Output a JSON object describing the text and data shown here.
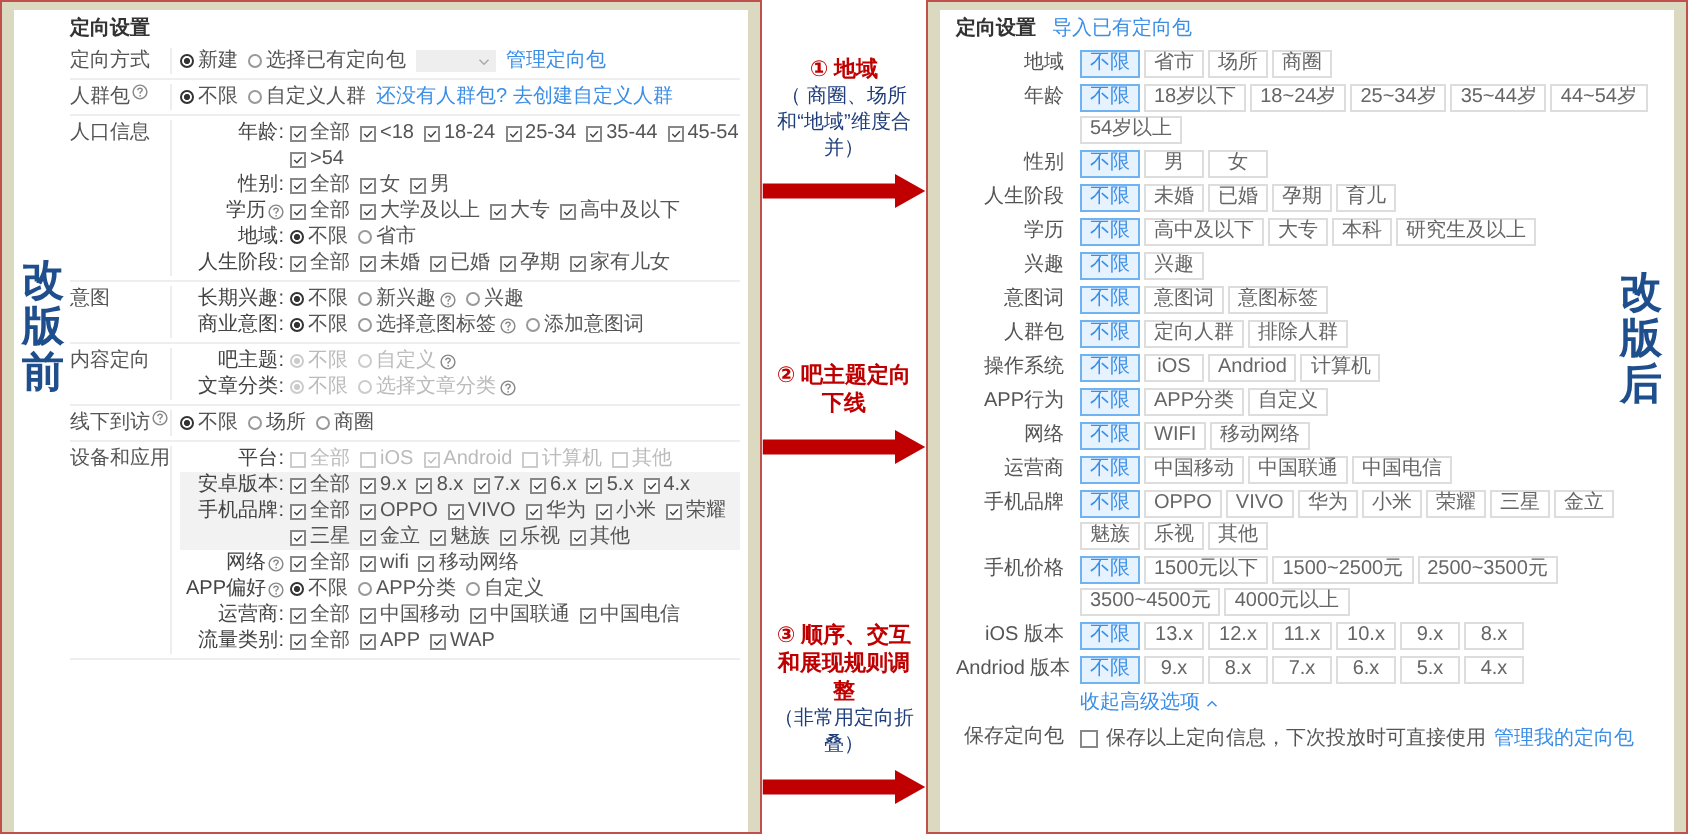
{
  "before": {
    "side_label": "改版前",
    "title": "定向设置",
    "sections": [
      {
        "label": "定向方式",
        "help": false,
        "rows": [
          {
            "kind": "radio",
            "disabled": false,
            "dropdown": true,
            "link": "管理定向包",
            "options": [
              {
                "text": "新建",
                "checked": true
              },
              {
                "text": "选择已有定向包",
                "checked": false
              }
            ]
          }
        ]
      },
      {
        "label": "人群包",
        "help": true,
        "rows": [
          {
            "kind": "radio",
            "disabled": false,
            "link": "还没有人群包? 去创建自定义人群",
            "options": [
              {
                "text": "不限",
                "checked": true
              },
              {
                "text": "自定义人群",
                "checked": false
              }
            ]
          }
        ]
      },
      {
        "label": "人口信息",
        "help": false,
        "rows": [
          {
            "label": "年龄:",
            "kind": "check",
            "disabled": false,
            "options": [
              {
                "text": "全部",
                "checked": true
              },
              {
                "text": "<18",
                "checked": true
              },
              {
                "text": "18-24",
                "checked": true
              },
              {
                "text": "25-34",
                "checked": true
              },
              {
                "text": "35-44",
                "checked": true
              },
              {
                "text": "45-54",
                "checked": true
              },
              {
                "text": ">54",
                "checked": true
              }
            ]
          },
          {
            "label": "性别:",
            "kind": "check",
            "disabled": false,
            "options": [
              {
                "text": "全部",
                "checked": true
              },
              {
                "text": "女",
                "checked": true
              },
              {
                "text": "男",
                "checked": true
              }
            ]
          },
          {
            "label": "学历",
            "help": true,
            "kind": "check",
            "disabled": false,
            "options": [
              {
                "text": "全部",
                "checked": true
              },
              {
                "text": "大学及以上",
                "checked": true
              },
              {
                "text": "大专",
                "checked": true
              },
              {
                "text": "高中及以下",
                "checked": true
              }
            ]
          },
          {
            "label": "地域:",
            "kind": "radio",
            "disabled": false,
            "options": [
              {
                "text": "不限",
                "checked": true
              },
              {
                "text": "省市",
                "checked": false
              }
            ]
          },
          {
            "label": "人生阶段:",
            "kind": "check",
            "disabled": false,
            "options": [
              {
                "text": "全部",
                "checked": true
              },
              {
                "text": "未婚",
                "checked": true
              },
              {
                "text": "已婚",
                "checked": true
              },
              {
                "text": "孕期",
                "checked": true
              },
              {
                "text": "家有儿女",
                "checked": true
              }
            ]
          }
        ]
      },
      {
        "label": "意图",
        "help": false,
        "rows": [
          {
            "label": "长期兴趣:",
            "kind": "radio",
            "disabled": false,
            "options": [
              {
                "text": "不限",
                "checked": true
              },
              {
                "text": "新兴趣",
                "checked": false,
                "help": true
              },
              {
                "text": "兴趣",
                "checked": false
              }
            ]
          },
          {
            "label": "商业意图:",
            "kind": "radio",
            "disabled": false,
            "options": [
              {
                "text": "不限",
                "checked": true
              },
              {
                "text": "选择意图标签",
                "checked": false,
                "help": true
              },
              {
                "text": "添加意图词",
                "checked": false
              }
            ]
          }
        ]
      },
      {
        "label": "内容定向",
        "help": false,
        "rows": [
          {
            "label": "吧主题:",
            "kind": "radio",
            "disabled": true,
            "options": [
              {
                "text": "不限",
                "checked": true
              },
              {
                "text": "自定义",
                "checked": false,
                "help": true
              }
            ]
          },
          {
            "label": "文章分类:",
            "kind": "radio",
            "disabled": true,
            "options": [
              {
                "text": "不限",
                "checked": true
              },
              {
                "text": "选择文章分类",
                "checked": false,
                "help": true
              }
            ]
          }
        ]
      },
      {
        "label": "线下到访",
        "help": true,
        "rows": [
          {
            "kind": "radio",
            "disabled": false,
            "options": [
              {
                "text": "不限",
                "checked": true
              },
              {
                "text": "场所",
                "checked": false
              },
              {
                "text": "商圈",
                "checked": false
              }
            ]
          }
        ]
      },
      {
        "label": "设备和应用",
        "help": false,
        "rows": [
          {
            "label": "平台:",
            "kind": "check",
            "disabled": true,
            "options": [
              {
                "text": "全部",
                "checked": false
              },
              {
                "text": "iOS",
                "checked": false
              },
              {
                "text": "Android",
                "checked": true
              },
              {
                "text": "计算机",
                "checked": false
              },
              {
                "text": "其他",
                "checked": false
              }
            ]
          },
          {
            "label": "安卓版本:",
            "kind": "check",
            "disabled": false,
            "boxed": true,
            "options": [
              {
                "text": "全部",
                "checked": true
              },
              {
                "text": "9.x",
                "checked": true
              },
              {
                "text": "8.x",
                "checked": true
              },
              {
                "text": "7.x",
                "checked": true
              },
              {
                "text": "6.x",
                "checked": true
              },
              {
                "text": "5.x",
                "checked": true
              },
              {
                "text": "4.x",
                "checked": true
              }
            ]
          },
          {
            "label": "手机品牌:",
            "kind": "check",
            "disabled": false,
            "boxed": true,
            "options": [
              {
                "text": "全部",
                "checked": true
              },
              {
                "text": "OPPO",
                "checked": true
              },
              {
                "text": "VIVO",
                "checked": true
              },
              {
                "text": "华为",
                "checked": true
              },
              {
                "text": "小米",
                "checked": true
              },
              {
                "text": "荣耀",
                "checked": true
              },
              {
                "text": "三星",
                "checked": true
              },
              {
                "text": "金立",
                "checked": true
              },
              {
                "text": "魅族",
                "checked": true
              },
              {
                "text": "乐视",
                "checked": true
              },
              {
                "text": "其他",
                "checked": true
              }
            ]
          },
          {
            "label": "网络",
            "help": true,
            "kind": "check",
            "disabled": false,
            "options": [
              {
                "text": "全部",
                "checked": true
              },
              {
                "text": "wifi",
                "checked": true
              },
              {
                "text": "移动网络",
                "checked": true
              }
            ]
          },
          {
            "label": "APP偏好",
            "help": true,
            "kind": "radio",
            "disabled": false,
            "options": [
              {
                "text": "不限",
                "checked": true
              },
              {
                "text": "APP分类",
                "checked": false
              },
              {
                "text": "自定义",
                "checked": false
              }
            ]
          },
          {
            "label": "运营商:",
            "kind": "check",
            "disabled": false,
            "options": [
              {
                "text": "全部",
                "checked": true
              },
              {
                "text": "中国移动",
                "checked": true
              },
              {
                "text": "中国联通",
                "checked": true
              },
              {
                "text": "中国电信",
                "checked": true
              }
            ]
          },
          {
            "label": "流量类别:",
            "kind": "check",
            "disabled": false,
            "options": [
              {
                "text": "全部",
                "checked": true
              },
              {
                "text": "APP",
                "checked": true
              },
              {
                "text": "WAP",
                "checked": true
              }
            ]
          }
        ]
      }
    ]
  },
  "notes": [
    {
      "number": "①",
      "title": "地域",
      "detail": "（ 商圈、场所和“地域”维度合并）"
    },
    {
      "number": "②",
      "title": "吧主题定向下线"
    },
    {
      "number": "③",
      "title": "顺序、交互和展现规则调整",
      "detail": "（非常用定向折叠）"
    }
  ],
  "after": {
    "side_label": "改版后",
    "title": "定向设置",
    "import_link": "导入已有定向包",
    "rows": [
      {
        "label": "地域",
        "options": [
          {
            "text": "不限",
            "selected": true
          },
          {
            "text": "省市",
            "selected": false
          },
          {
            "text": "场所",
            "selected": false
          },
          {
            "text": "商圈",
            "selected": false
          }
        ]
      },
      {
        "label": "年龄",
        "options": [
          {
            "text": "不限",
            "selected": true
          },
          {
            "text": "18岁以下",
            "selected": false
          },
          {
            "text": "18~24岁",
            "selected": false
          },
          {
            "text": "25~34岁",
            "selected": false
          },
          {
            "text": "35~44岁",
            "selected": false
          },
          {
            "text": "44~54岁",
            "selected": false
          },
          {
            "text": "54岁以上",
            "selected": false
          }
        ]
      },
      {
        "label": "性别",
        "options": [
          {
            "text": "不限",
            "selected": true
          },
          {
            "text": "男",
            "selected": false
          },
          {
            "text": "女",
            "selected": false
          }
        ]
      },
      {
        "label": "人生阶段",
        "options": [
          {
            "text": "不限",
            "selected": true
          },
          {
            "text": "未婚",
            "selected": false
          },
          {
            "text": "已婚",
            "selected": false
          },
          {
            "text": "孕期",
            "selected": false
          },
          {
            "text": "育儿",
            "selected": false
          }
        ]
      },
      {
        "label": "学历",
        "options": [
          {
            "text": "不限",
            "selected": true
          },
          {
            "text": "高中及以下",
            "selected": false
          },
          {
            "text": "大专",
            "selected": false
          },
          {
            "text": "本科",
            "selected": false
          },
          {
            "text": "研究生及以上",
            "selected": false
          }
        ]
      },
      {
        "label": "兴趣",
        "options": [
          {
            "text": "不限",
            "selected": true
          },
          {
            "text": "兴趣",
            "selected": false
          }
        ]
      },
      {
        "label": "意图词",
        "options": [
          {
            "text": "不限",
            "selected": true
          },
          {
            "text": "意图词",
            "selected": false
          },
          {
            "text": "意图标签",
            "selected": false
          }
        ]
      },
      {
        "label": "人群包",
        "options": [
          {
            "text": "不限",
            "selected": true
          },
          {
            "text": "定向人群",
            "selected": false
          },
          {
            "text": "排除人群",
            "selected": false
          }
        ]
      },
      {
        "label": "操作系统",
        "options": [
          {
            "text": "不限",
            "selected": true
          },
          {
            "text": "iOS",
            "selected": false
          },
          {
            "text": "Andriod",
            "selected": false
          },
          {
            "text": "计算机",
            "selected": false
          }
        ]
      },
      {
        "label": "APP行为",
        "options": [
          {
            "text": "不限",
            "selected": true
          },
          {
            "text": "APP分类",
            "selected": false
          },
          {
            "text": "自定义",
            "selected": false
          }
        ]
      },
      {
        "label": "网络",
        "options": [
          {
            "text": "不限",
            "selected": true
          },
          {
            "text": "WIFI",
            "selected": false
          },
          {
            "text": "移动网络",
            "selected": false
          }
        ]
      },
      {
        "label": "运营商",
        "options": [
          {
            "text": "不限",
            "selected": true
          },
          {
            "text": "中国移动",
            "selected": false
          },
          {
            "text": "中国联通",
            "selected": false
          },
          {
            "text": "中国电信",
            "selected": false
          }
        ]
      },
      {
        "label": "手机品牌",
        "options": [
          {
            "text": "不限",
            "selected": true
          },
          {
            "text": "OPPO",
            "selected": false
          },
          {
            "text": "VIVO",
            "selected": false
          },
          {
            "text": "华为",
            "selected": false
          },
          {
            "text": "小米",
            "selected": false
          },
          {
            "text": "荣耀",
            "selected": false
          },
          {
            "text": "三星",
            "selected": false
          },
          {
            "text": "金立",
            "selected": false
          },
          {
            "text": "魅族",
            "selected": false
          },
          {
            "text": "乐视",
            "selected": false
          },
          {
            "text": "其他",
            "selected": false
          }
        ]
      },
      {
        "label": "手机价格",
        "options": [
          {
            "text": "不限",
            "selected": true
          },
          {
            "text": "1500元以下",
            "selected": false
          },
          {
            "text": "1500~2500元",
            "selected": false
          },
          {
            "text": "2500~3500元",
            "selected": false
          },
          {
            "text": "3500~4500元",
            "selected": false
          },
          {
            "text": "4000元以上",
            "selected": false
          }
        ]
      },
      {
        "label": "iOS 版本",
        "options": [
          {
            "text": "不限",
            "selected": true
          },
          {
            "text": "13.x",
            "selected": false
          },
          {
            "text": "12.x",
            "selected": false
          },
          {
            "text": "11.x",
            "selected": false
          },
          {
            "text": "10.x",
            "selected": false
          },
          {
            "text": "9.x",
            "selected": false
          },
          {
            "text": "8.x",
            "selected": false
          }
        ]
      },
      {
        "label": "Andriod 版本",
        "options": [
          {
            "text": "不限",
            "selected": true
          },
          {
            "text": "9.x",
            "selected": false
          },
          {
            "text": "8.x",
            "selected": false
          },
          {
            "text": "7.x",
            "selected": false
          },
          {
            "text": "6.x",
            "selected": false
          },
          {
            "text": "5.x",
            "selected": false
          },
          {
            "text": "4.x",
            "selected": false
          }
        ]
      }
    ],
    "collapse_link": "收起高级选项",
    "save": {
      "label": "保存定向包",
      "checked": false,
      "text": "保存以上定向信息，下次投放时可直接使用",
      "link": "管理我的定向包"
    }
  }
}
